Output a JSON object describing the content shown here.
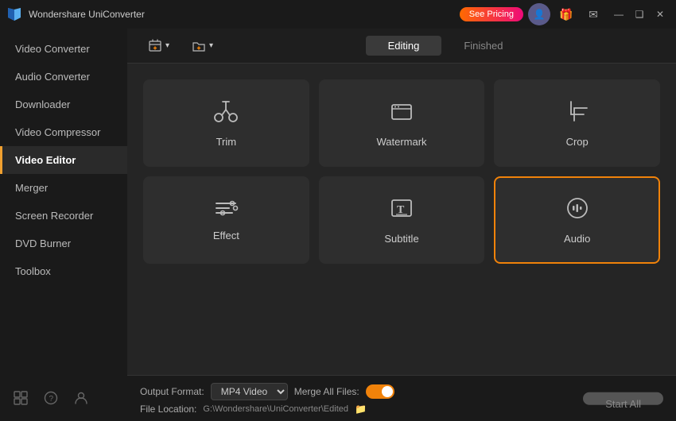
{
  "app": {
    "title": "Wondershare UniConverter",
    "icon_label": "W"
  },
  "titlebar": {
    "pricing_btn": "See Pricing",
    "win_minimize": "—",
    "win_restore": "❑",
    "win_close": "✕"
  },
  "sidebar": {
    "items": [
      {
        "id": "video-converter",
        "label": "Video Converter",
        "active": false
      },
      {
        "id": "audio-converter",
        "label": "Audio Converter",
        "active": false
      },
      {
        "id": "downloader",
        "label": "Downloader",
        "active": false
      },
      {
        "id": "video-compressor",
        "label": "Video Compressor",
        "active": false
      },
      {
        "id": "video-editor",
        "label": "Video Editor",
        "active": true
      },
      {
        "id": "merger",
        "label": "Merger",
        "active": false
      },
      {
        "id": "screen-recorder",
        "label": "Screen Recorder",
        "active": false
      },
      {
        "id": "dvd-burner",
        "label": "DVD Burner",
        "active": false
      },
      {
        "id": "toolbox",
        "label": "Toolbox",
        "active": false
      }
    ]
  },
  "tabs": {
    "editing_label": "Editing",
    "finished_label": "Finished"
  },
  "toolbar": {
    "add_file_label": "Add Files",
    "add_folder_label": "Add Folder"
  },
  "cards": {
    "row1": [
      {
        "id": "trim",
        "label": "Trim",
        "icon": "scissors",
        "selected": false
      },
      {
        "id": "watermark",
        "label": "Watermark",
        "icon": "watermark",
        "selected": false
      },
      {
        "id": "crop",
        "label": "Crop",
        "icon": "crop",
        "selected": false
      }
    ],
    "row2": [
      {
        "id": "effect",
        "label": "Effect",
        "icon": "effect",
        "selected": false
      },
      {
        "id": "subtitle",
        "label": "Subtitle",
        "icon": "subtitle",
        "selected": false
      },
      {
        "id": "audio",
        "label": "Audio",
        "icon": "audio",
        "selected": true
      }
    ]
  },
  "bottom": {
    "output_format_label": "Output Format:",
    "output_format_value": "MP4 Video",
    "merge_label": "Merge All Files:",
    "file_location_label": "File Location:",
    "file_path": "G:\\Wondershare\\UniConverter\\Edited",
    "start_btn": "Start All"
  }
}
